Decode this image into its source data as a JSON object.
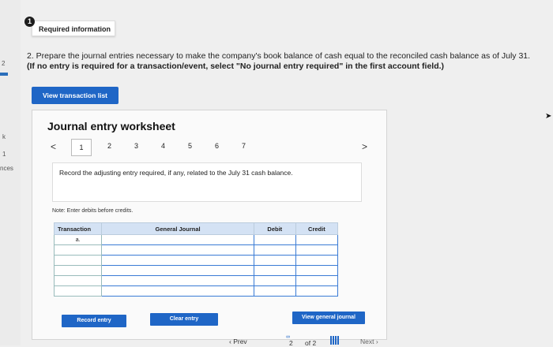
{
  "left_edge": {
    "t1": "2",
    "t2": "k",
    "t3": "1",
    "t4": "nces"
  },
  "info_icon_glyph": "1",
  "required_info_label": "Required information",
  "question": {
    "text": "2. Prepare the journal entries necessary to make the company's book balance of cash equal to the reconciled cash balance as of July 31.",
    "bold_text": "(If no entry is required for a transaction/event, select \"No journal entry required\" in the first account field.)"
  },
  "view_transaction_list_label": "View transaction list",
  "worksheet": {
    "title": "Journal entry worksheet",
    "tabs": [
      "1",
      "2",
      "3",
      "4",
      "5",
      "6",
      "7"
    ],
    "prev_arrow": "<",
    "next_arrow": ">",
    "instruction": "Record the adjusting entry required, if any, related to the July 31 cash balance.",
    "note": "Note: Enter debits before credits.",
    "columns": [
      "Transaction",
      "General Journal",
      "Debit",
      "Credit"
    ],
    "first_row_transaction": "a.",
    "record_entry_label": "Record entry",
    "clear_entry_label": "Clear entry",
    "view_general_journal_label": "View general journal"
  },
  "footer": {
    "prev_label": "Prev",
    "page_current": "2",
    "page_of": "of 2",
    "next_label": "Next"
  },
  "colors": {
    "accent": "#1f66c6",
    "header_bg": "#d4e2f4"
  }
}
